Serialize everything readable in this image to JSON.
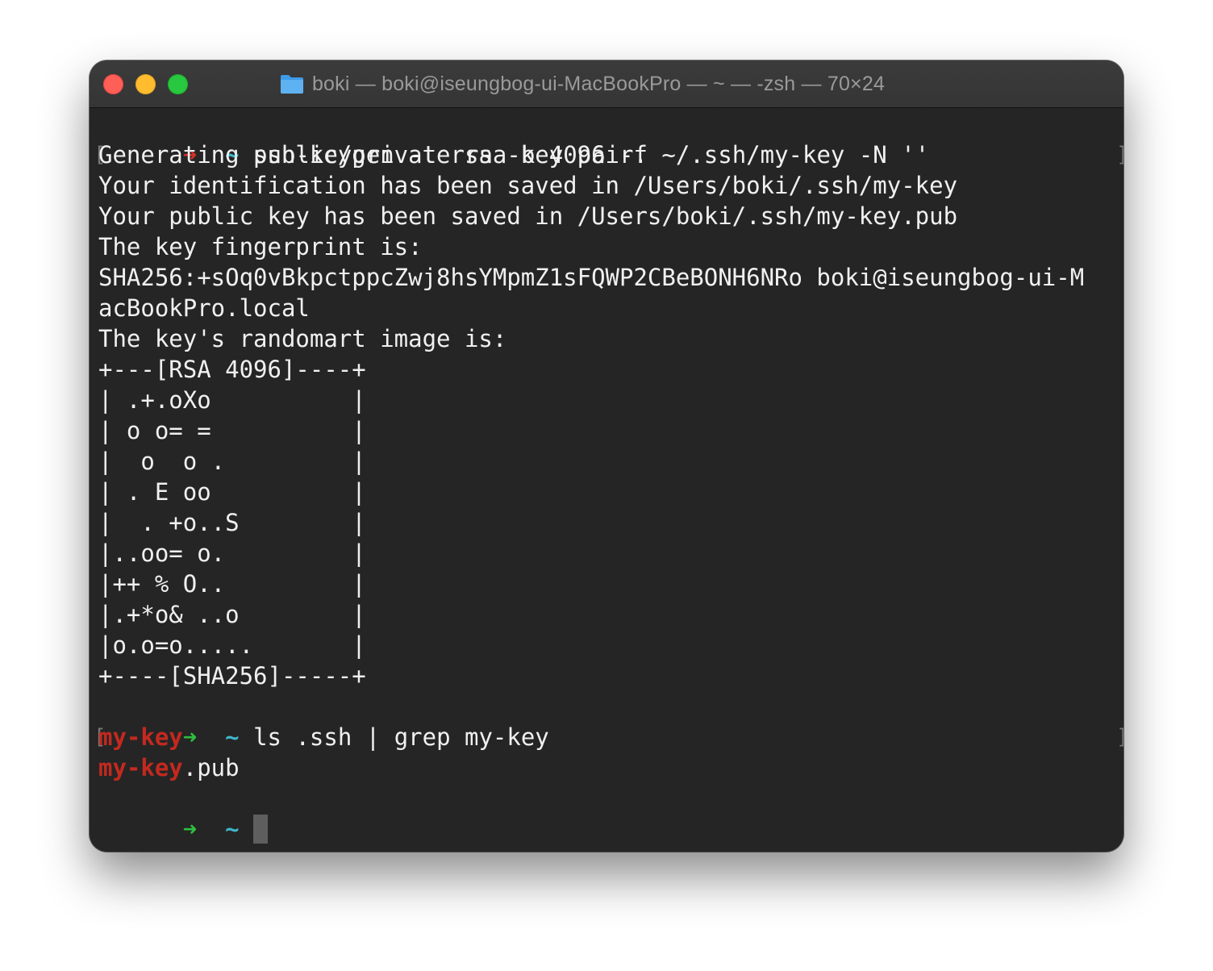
{
  "window": {
    "title": "boki — boki@iseungbog-ui-MacBookPro — ~ — -zsh — 70×24"
  },
  "terminal": {
    "prompt1": {
      "arrow": "➜",
      "dir": "~",
      "command": "ssh-keygen -t rsa -b 4096 -f ~/.ssh/my-key -N ''"
    },
    "output1": [
      "Generating public/private rsa key pair.",
      "Your identification has been saved in /Users/boki/.ssh/my-key",
      "Your public key has been saved in /Users/boki/.ssh/my-key.pub",
      "The key fingerprint is:",
      "SHA256:+sOq0vBkpctppcZwj8hsYMpmZ1sFQWP2CBeBONH6NRo boki@iseungbog-ui-M",
      "acBookPro.local",
      "The key's randomart image is:",
      "+---[RSA 4096]----+",
      "| .+.oXo          |",
      "| o o= =          |",
      "|  o  o .         |",
      "| . E oo          |",
      "|  . +o..S        |",
      "|..oo= o.         |",
      "|++ % O..         |",
      "|.+*o& ..o        |",
      "|o.o=o.....       |",
      "+----[SHA256]-----+"
    ],
    "prompt2": {
      "arrow": "➜",
      "dir": "~",
      "command": "ls .ssh | grep my-key"
    },
    "output2": {
      "match1": "my-key",
      "match2": "my-key",
      "match2_suffix": ".pub"
    },
    "prompt3": {
      "arrow": "➜",
      "dir": "~"
    }
  },
  "colors": {
    "error_arrow": "#d0312d",
    "ok_arrow": "#2fbf3f",
    "tilde": "#3fb5c8",
    "grep_match": "#c3291f",
    "background": "#252525"
  }
}
